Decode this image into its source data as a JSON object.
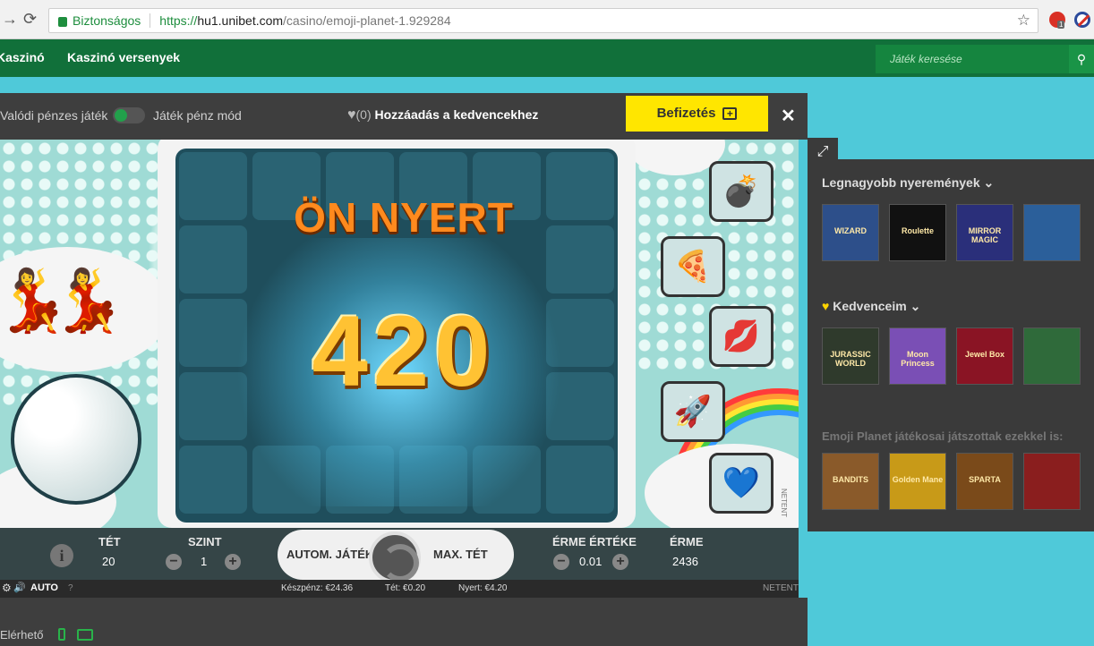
{
  "browser": {
    "secure_label": "Biztonságos",
    "url_scheme": "https://",
    "url_host": "hu1.unibet.com",
    "url_path": "/casino/emoji-planet-1.929284",
    "ext_badge": "1"
  },
  "site_nav": {
    "items": [
      "Kaszinó",
      "Kaszinó versenyek"
    ],
    "search_placeholder": "Játék keresése"
  },
  "game_bar": {
    "real_money_label": "Valódi pénzes játék",
    "play_money_label": "Játék pénz mód",
    "fav_count": "(0)",
    "fav_label": "Hozzáadás a kedvencekhez",
    "deposit_label": "Befizetés"
  },
  "game": {
    "win_title": "ÖN NYERT",
    "win_amount": "420",
    "provider_vertical": "NETENT"
  },
  "controls": {
    "bet_label": "TÉT",
    "bet_value": "20",
    "level_label": "SZINT",
    "level_value": "1",
    "autoplay_label": "AUTOM. JÁTÉK",
    "maxbet_label": "MAX. TÉT",
    "coin_value_label": "ÉRME ÉRTÉKE",
    "coin_value": "0.01",
    "coins_label": "ÉRME",
    "coins_value": "2436"
  },
  "status_bar": {
    "auto_label": "AUTO",
    "help": "?",
    "cash": "Készpénz: €24.36",
    "bet": "Tét: €0.20",
    "win": "Nyert: €4.20",
    "provider": "NETENT"
  },
  "bottom": {
    "available_label": "Elérhető"
  },
  "right_panel": {
    "biggest_wins_title": "Legnagyobb nyeremények",
    "favorites_title": "Kedvenceim",
    "also_played_title": "Emoji Planet játékosai játszottak ezekkel is:",
    "biggest_wins": [
      {
        "label": "WIZARD",
        "bg": "#2d4f8a"
      },
      {
        "label": "Roulette",
        "bg": "#111111"
      },
      {
        "label": "MIRROR MAGIC",
        "bg": "#2a2f7a"
      },
      {
        "label": "",
        "bg": "#2b5f9a"
      }
    ],
    "favorites": [
      {
        "label": "JURASSIC WORLD",
        "bg": "#2f3a2c"
      },
      {
        "label": "Moon Princess",
        "bg": "#7a4fb5"
      },
      {
        "label": "Jewel Box",
        "bg": "#8a1424"
      },
      {
        "label": "",
        "bg": "#2f6a3a"
      }
    ],
    "also_played": [
      {
        "label": "BANDITS",
        "bg": "#8a5a2a"
      },
      {
        "label": "Golden Mane",
        "bg": "#c89a18"
      },
      {
        "label": "SPARTA",
        "bg": "#7a4a1a"
      },
      {
        "label": "",
        "bg": "#8a1e1e"
      }
    ]
  },
  "colors": {
    "site_green": "#11703a",
    "deposit_yellow": "#ffe600",
    "toggle_on": "#22a04b",
    "win_orange": "#ff8a1e"
  }
}
